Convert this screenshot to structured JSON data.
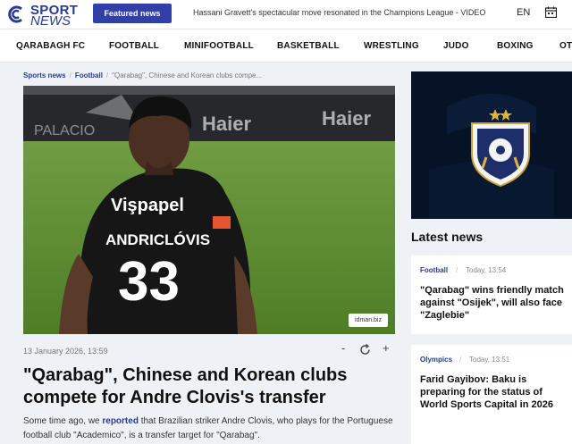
{
  "header": {
    "logo_top": "SPORT",
    "logo_bottom": "NEWS",
    "featured_label": "Featured news",
    "ticker_text": "Hassani Gravett's spectacular move resonated in the Champions League - VIDEO",
    "language": "EN",
    "calendar_icon": "calendar-icon"
  },
  "nav": {
    "items": [
      "QARABAGH FC",
      "FOOTBALL",
      "MINIFOOTBALL",
      "BASKETBALL",
      "WRESTLING",
      "JUDO",
      "BOXING",
      "OT"
    ]
  },
  "breadcrumb": {
    "items": [
      "Sports news",
      "Football",
      "\"Qarabag\", Chinese and Korean clubs compe..."
    ]
  },
  "article": {
    "image": {
      "shirt_sponsor": "Vişpapel",
      "player_name": "ANDRICLÓVIS",
      "number": "33",
      "credit": "idman.biz"
    },
    "date": "13 January 2026, 13:59",
    "tools": {
      "decrease": "-",
      "refresh_icon": "refresh-icon",
      "increase": "+"
    },
    "headline": "\"Qarabag\", Chinese and Korean clubs compete for Andre Clovis's transfer",
    "lead_before": "Some time ago, we ",
    "lead_link": "reported",
    "lead_after": " that Brazilian striker Andre Clovis, who plays for the Portuguese football club \"Academico\", is a transfer target for \"Qarabag\"."
  },
  "sidebar": {
    "latest_title": "Latest news",
    "cards": [
      {
        "category": "Football",
        "time": "Today, 13:54",
        "title": "\"Qarabag\" wins friendly match against \"Osijek\", will also face \"Zaglebie\""
      },
      {
        "category": "Olympics",
        "time": "Today, 13:51",
        "title": "Farid Gayibov: Baku is preparing for the status of World Sports Capital in 2026"
      }
    ]
  },
  "colors": {
    "brand": "#2a3c8f",
    "featured_bg": "#3140a8",
    "page_bg": "#eef1f6"
  }
}
